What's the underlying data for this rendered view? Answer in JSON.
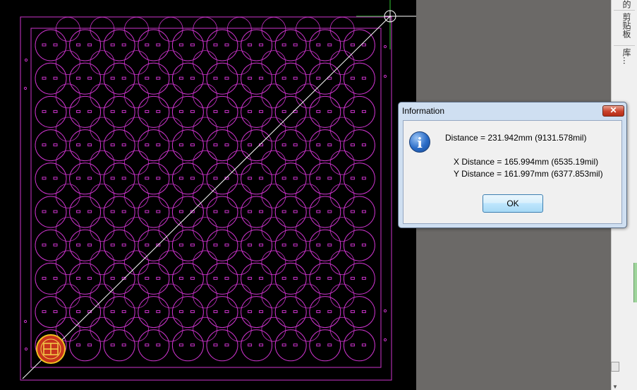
{
  "dialog": {
    "title": "Information",
    "distance_line": "Distance = 231.942mm (9131.578mil)",
    "x_distance_line": "X Distance = 165.994mm (6535.19mil)",
    "y_distance_line": "Y Distance = 161.997mm (6377.853mil)",
    "ok_label": "OK",
    "close_glyph": "✕",
    "info_glyph": "i"
  },
  "side_panel": {
    "tabs": [
      "的",
      "剪贴板",
      "库..."
    ]
  },
  "canvas": {
    "background": "#000000",
    "outline_color": "#cc33cc",
    "measure_line_color": "#ffffff",
    "cursor_color": "#ffffff",
    "component_grid_rows": 10,
    "component_grid_cols": 10
  }
}
